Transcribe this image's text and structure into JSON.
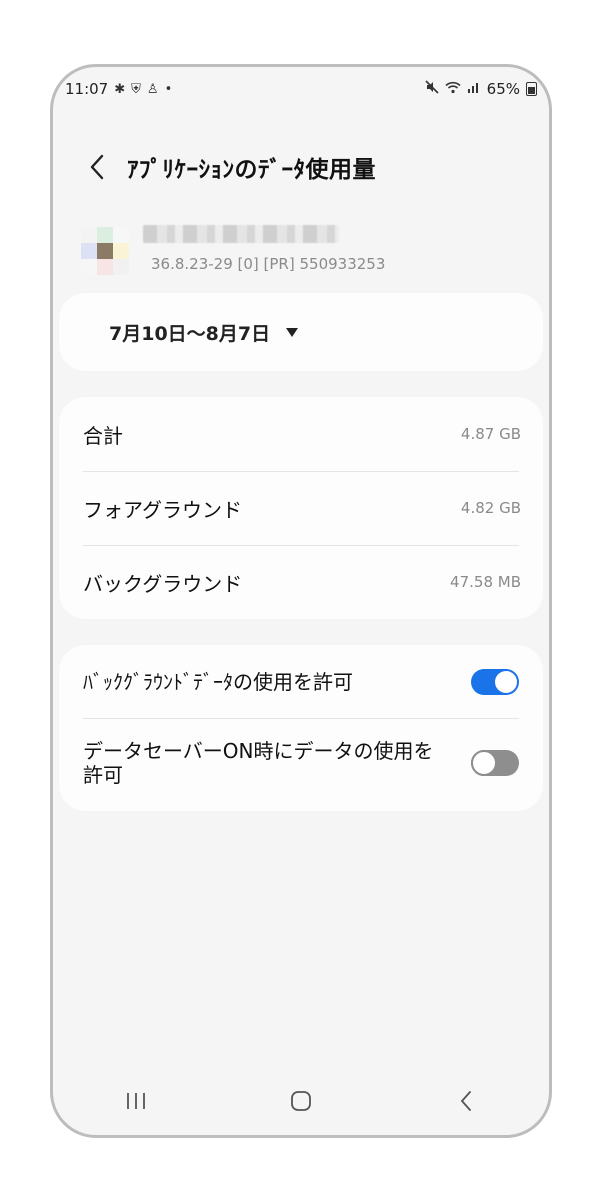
{
  "status_bar": {
    "time": "11:07",
    "battery": "65%",
    "left_icons": [
      "gear-icon",
      "shield-icon",
      "person-icon",
      "dot-icon"
    ],
    "right_icons": [
      "mute-icon",
      "wifi-icon",
      "signal-icon",
      "battery-icon"
    ]
  },
  "header": {
    "title": "ｱﾌﾟﾘｹｰｼｮﾝのﾃﾞｰﾀ使用量"
  },
  "app": {
    "version": "36.8.23-29 [0] [PR] 550933253"
  },
  "date_range": {
    "label": "7月10日～8月7日"
  },
  "usage": {
    "rows": [
      {
        "label": "合計",
        "value": "4.87 GB"
      },
      {
        "label": "フォアグラウンド",
        "value": "4.82 GB"
      },
      {
        "label": "バックグラウンド",
        "value": "47.58 MB"
      }
    ]
  },
  "toggles": {
    "background_data": {
      "label": "ﾊﾞｯｸｸﾞﾗｳﾝﾄﾞﾃﾞｰﾀの使用を許可",
      "enabled": true
    },
    "data_saver": {
      "label": "データセーバーON時にデータの使用を許可",
      "enabled": false
    }
  },
  "colors": {
    "accent": "#1a73e8",
    "background": "#f5f5f5",
    "card": "#fdfdfd"
  }
}
